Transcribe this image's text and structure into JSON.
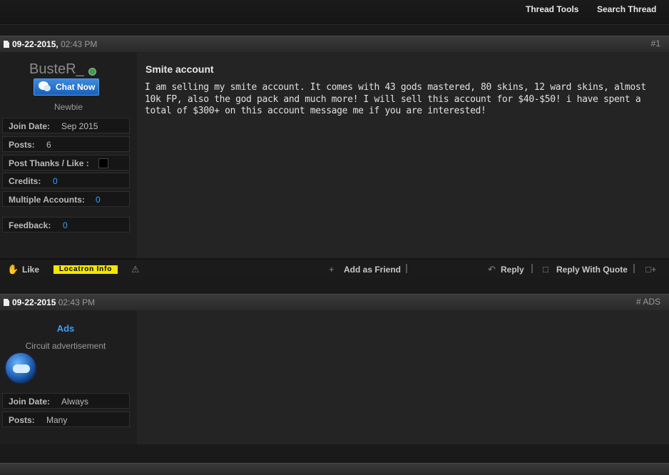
{
  "toolbar": {
    "thread_tools": "Thread Tools",
    "search_thread": "Search Thread"
  },
  "post1": {
    "date": "09-22-2015,",
    "time": "02:43 PM",
    "number": "#1",
    "username": "BusteR_",
    "chat_label": "Chat Now",
    "user_title": "Newbie",
    "info": {
      "join_date_label": "Join Date:",
      "join_date_value": "Sep 2015",
      "posts_label": "Posts:",
      "posts_value": "6",
      "thanks_label": "Post Thanks / Like :",
      "credits_label": "Credits:",
      "credits_value": "0",
      "multi_label": "Multiple Accounts:",
      "multi_value": "0",
      "feedback_label": "Feedback:",
      "feedback_value": "0"
    },
    "title": "Smite account",
    "text": "I am selling my smite account. It comes with 43 gods mastered, 80 skins, 12 ward skins, almost 10k FP, also the god pack and much more! I will sell this account for $40-$50! i have spent a total of $300+ on this account message me if you are interested!",
    "footer": {
      "like": "Like",
      "locatron": "Locatron Info",
      "add_friend": "Add as Friend",
      "reply": "Reply",
      "reply_quote": "Reply With Quote"
    }
  },
  "post2": {
    "date": "09-22-2015",
    "time": "02:43 PM",
    "number": "# ADS",
    "username": "Ads",
    "user_title": "Circuit advertisement",
    "info": {
      "join_date_label": "Join Date:",
      "join_date_value": "Always",
      "posts_label": "Posts:",
      "posts_value": "Many"
    }
  },
  "colors": {
    "link_blue": "#3aa0ff",
    "chat_blue": "#1b5fb8",
    "locatron_yellow": "#f4e600"
  }
}
